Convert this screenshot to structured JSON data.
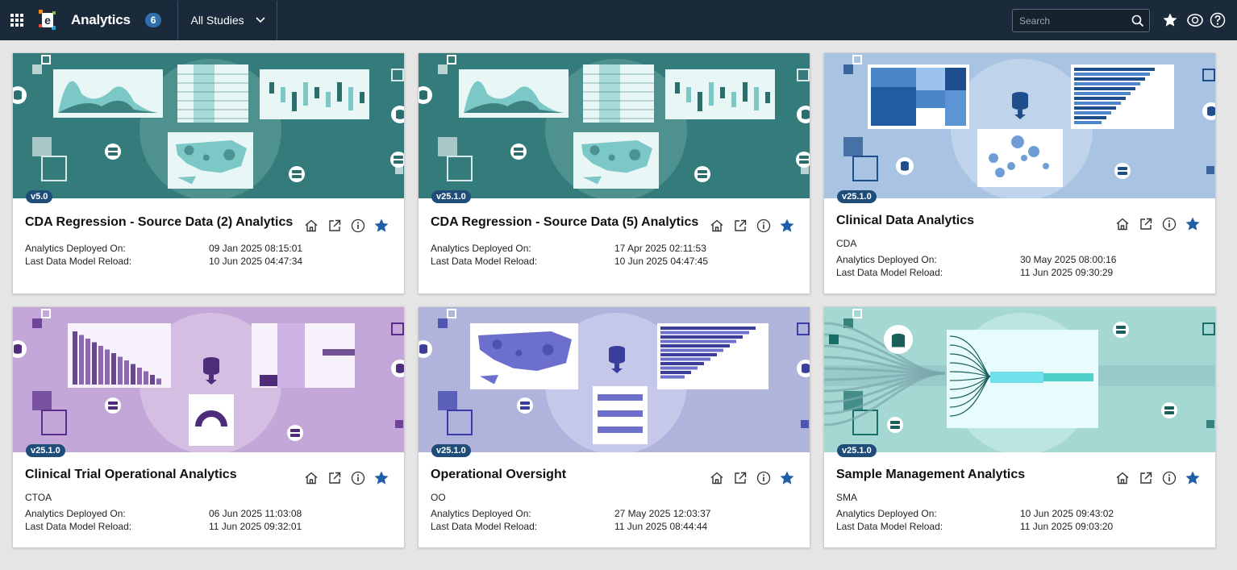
{
  "header": {
    "app_title": "Analytics",
    "count": "6",
    "studies_label": "All Studies",
    "search_placeholder": "Search",
    "icons": [
      "apps-grid-icon",
      "favorites-star-icon",
      "currency-icon",
      "help-icon"
    ]
  },
  "labels": {
    "deployed": "Analytics Deployed On:",
    "reload": "Last Data Model Reload:"
  },
  "cards": [
    {
      "version": "v5.0",
      "title": "CDA Regression - Source Data (2) Analytics",
      "abbr": "",
      "deployed": "09 Jan 2025 08:15:01",
      "reload": "10 Jun 2025 04:47:34",
      "theme": "teal"
    },
    {
      "version": "v25.1.0",
      "title": "CDA Regression - Source Data (5) Analytics",
      "abbr": "",
      "deployed": "17 Apr 2025 02:11:53",
      "reload": "10 Jun 2025 04:47:45",
      "theme": "teal"
    },
    {
      "version": "v25.1.0",
      "title": "Clinical Data Analytics",
      "abbr": "CDA",
      "deployed": "30 May 2025 08:00:16",
      "reload": "11 Jun 2025 09:30:29",
      "theme": "blue"
    },
    {
      "version": "v25.1.0",
      "title": "Clinical Trial Operational Analytics",
      "abbr": "CTOA",
      "deployed": "06 Jun 2025 11:03:08",
      "reload": "11 Jun 2025 09:32:01",
      "theme": "purple"
    },
    {
      "version": "v25.1.0",
      "title": "Operational Oversight",
      "abbr": "OO",
      "deployed": "27 May 2025 12:03:37",
      "reload": "11 Jun 2025 08:44:44",
      "theme": "lavender"
    },
    {
      "version": "v25.1.0",
      "title": "Sample Management Analytics",
      "abbr": "SMA",
      "deployed": "10 Jun 2025 09:43:02",
      "reload": "11 Jun 2025 09:03:20",
      "theme": "aqua"
    }
  ],
  "colors": {
    "topbar": "#1b2a3a",
    "accent": "#2f6fae",
    "star": "#1f5fa8"
  }
}
